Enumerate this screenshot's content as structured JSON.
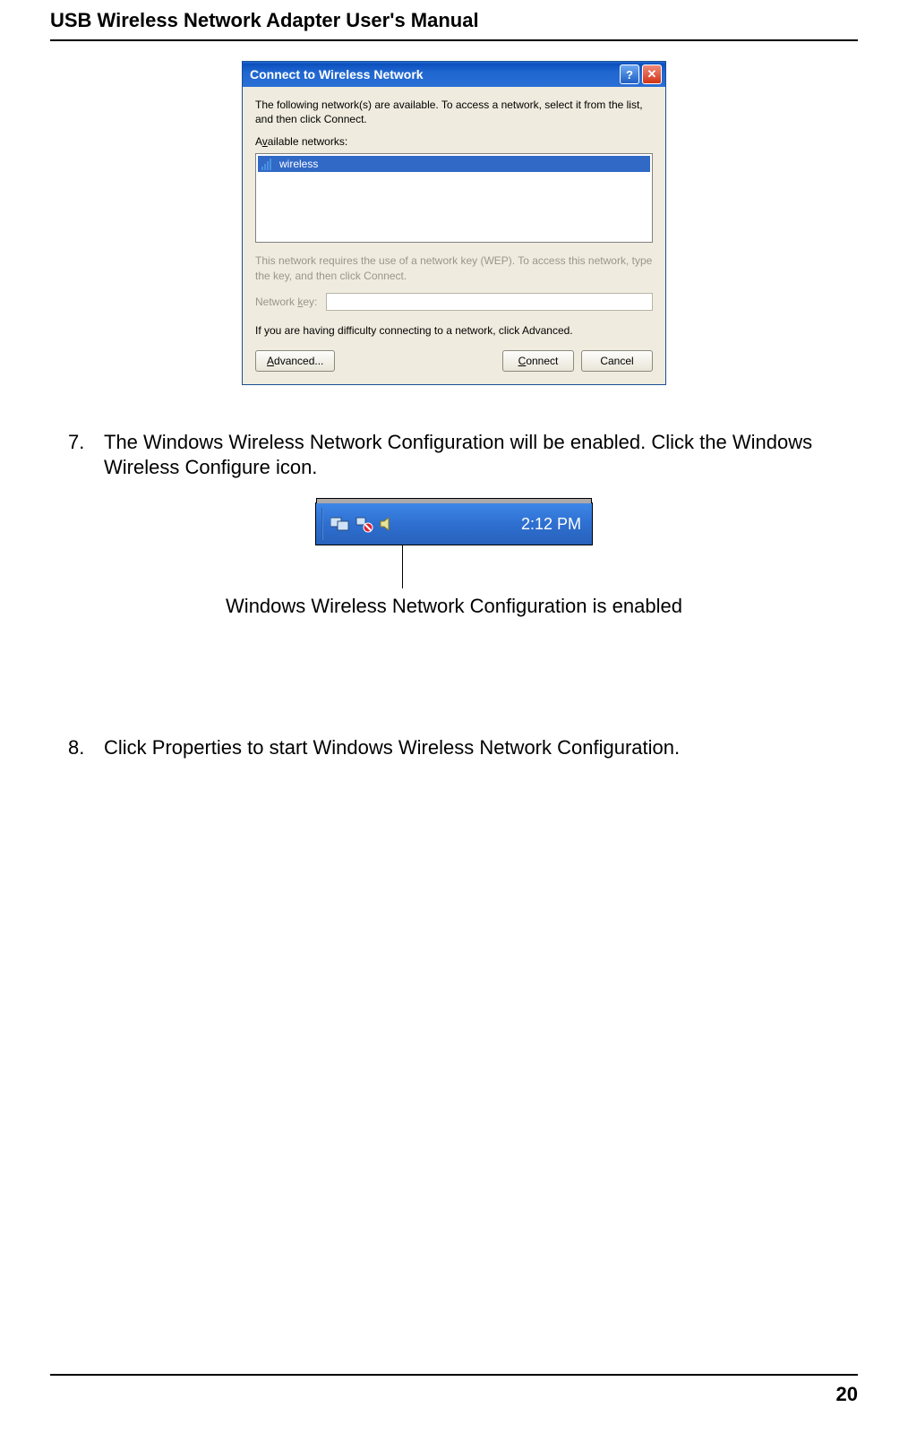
{
  "header": {
    "title": "USB Wireless Network Adapter User's Manual"
  },
  "dialog": {
    "title": "Connect to Wireless Network",
    "intro": "The following network(s) are available. To access a network, select it from the list, and then click Connect.",
    "available_label": "Available networks:",
    "network_name": "wireless",
    "key_note": "This network requires the use of a network key (WEP). To access this network, type the key, and then click Connect.",
    "key_label": "Network key:",
    "difficulty_text": "If you are having difficulty connecting to a network, click Advanced.",
    "advanced_btn": "Advanced...",
    "advanced_accel": "A",
    "connect_btn": "Connect",
    "connect_accel": "C",
    "cancel_btn": "Cancel"
  },
  "steps": {
    "s7_num": "7.",
    "s7_text": "The Windows Wireless Network Configuration will be enabled. Click the Windows Wireless Configure icon.",
    "s8_num": "8.",
    "s8_text": "Click Properties to start Windows Wireless Network Configuration."
  },
  "tray": {
    "time": "2:12 PM",
    "caption": "Windows Wireless Network Configuration is enabled"
  },
  "footer": {
    "page": "20"
  }
}
